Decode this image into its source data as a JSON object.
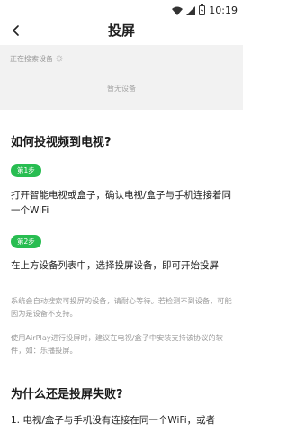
{
  "status_bar": {
    "time": "10:19",
    "icons": [
      "wifi-icon",
      "signal-icon",
      "battery-charging-icon"
    ]
  },
  "header": {
    "title": "投屏",
    "back_icon": "chevron-left-icon"
  },
  "search": {
    "status_text": "正在搜索设备",
    "empty_text": "暂无设备"
  },
  "guide": {
    "title": "如何投视频到电视?",
    "steps": [
      {
        "badge": "第1步",
        "text": "打开智能电视或盒子，确认电视/盒子与手机连接着同一个WiFi"
      },
      {
        "badge": "第2步",
        "text": "在上方设备列表中，选择投屏设备，即可开始投屏"
      }
    ],
    "notes": [
      "系统会自动搜索可投屏的设备，请耐心等待。若检测不到设备，可能因为是设备不支持。",
      "使用AirPlay进行投屏时，建议在电视/盒子中安装支持该协议的软件，如：乐播投屏。"
    ]
  },
  "failure": {
    "title": "为什么还是投屏失败?",
    "reasons": [
      "1. 电视/盒子与手机没有连接在同一个WiFi，或者"
    ]
  }
}
